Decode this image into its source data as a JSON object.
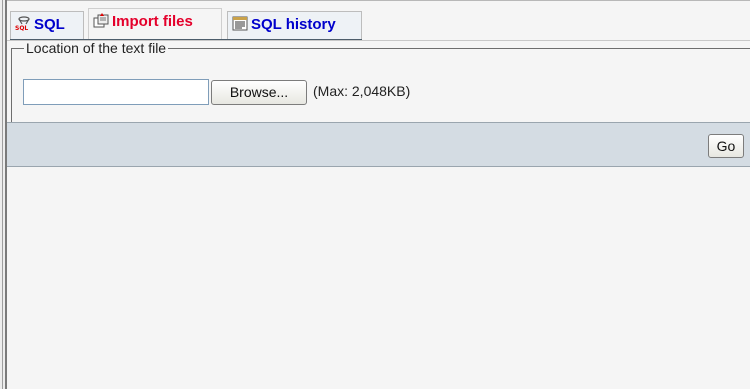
{
  "tabs": [
    {
      "label": "SQL",
      "icon": "sql-icon",
      "active": false
    },
    {
      "label": "Import files",
      "icon": "import-files-icon",
      "active": true
    },
    {
      "label": "SQL history",
      "icon": "sql-history-icon",
      "active": false
    }
  ],
  "import_form": {
    "legend": "Location of the text file",
    "file_input_value": "",
    "browse_label": "Browse...",
    "max_size_text": "(Max: 2,048KB)"
  },
  "actions": {
    "go_label": "Go"
  },
  "colors": {
    "active_tab_text": "#e4002b",
    "inactive_tab_text": "#0000cc",
    "go_bar_background": "#d4dce3"
  }
}
